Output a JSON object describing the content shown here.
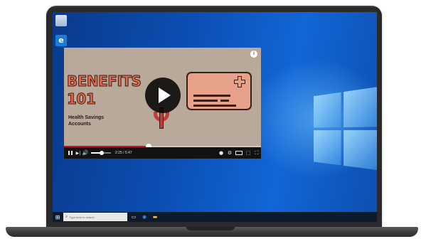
{
  "desktop": {
    "icons": [
      {
        "name": "recycle-bin-icon",
        "glyph": ""
      },
      {
        "name": "edge-icon",
        "glyph": "e"
      }
    ]
  },
  "taskbar": {
    "start_glyph": "⊞",
    "search_placeholder": "Type here to search",
    "search_glyph": "⌕",
    "pinned": [
      {
        "name": "task-view-icon",
        "glyph": "▭"
      },
      {
        "name": "edge-taskbar-icon",
        "glyph": "◉"
      },
      {
        "name": "file-explorer-icon",
        "glyph": "▬"
      }
    ]
  },
  "video": {
    "title_line1": "BENEFITS",
    "title_line2": "101",
    "subtitle": "Health Savings Accounts",
    "info_glyph": "i",
    "progress": 0.43,
    "volume": 0.55,
    "current_time": "2:25",
    "duration": "5:47",
    "time_separator": "/",
    "controls": {
      "next_glyph": "▶|",
      "volume_glyph": "🔊",
      "cc_glyph": "●",
      "settings_glyph": "⚙",
      "miniplayer_glyph": "⬚",
      "fullscreen_glyph": "⛶"
    }
  },
  "colors": {
    "accent_progress": "#c8102e",
    "video_bg": "#b8a99b",
    "title_orange": "#e86a4a"
  }
}
